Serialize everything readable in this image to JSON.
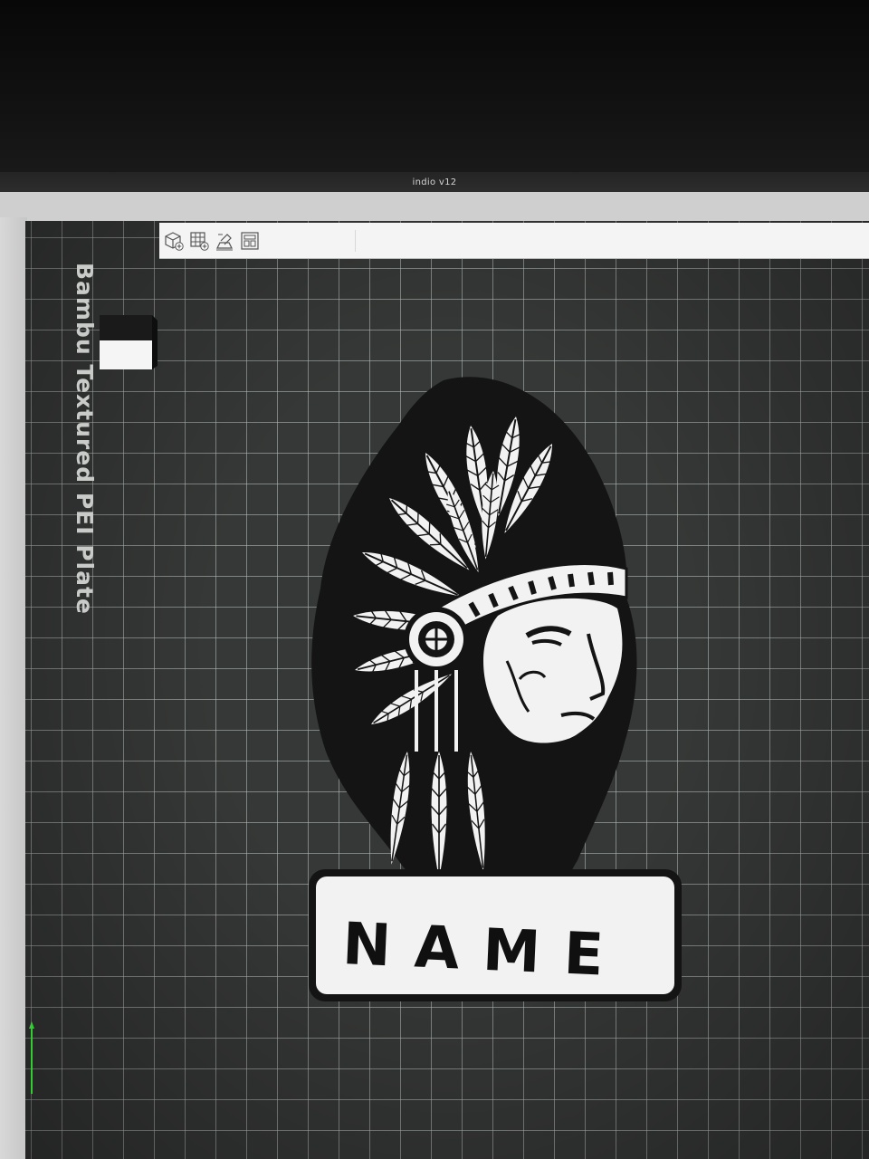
{
  "window": {
    "title": "indio v12"
  },
  "toolbar": {
    "buttons": [
      {
        "name": "add-object",
        "icon": "cube-add-icon"
      },
      {
        "name": "add-plate",
        "icon": "grid-add-icon"
      },
      {
        "name": "auto-orient",
        "icon": "auto-orient-icon"
      },
      {
        "name": "arrange",
        "icon": "arrange-icon"
      }
    ]
  },
  "plate": {
    "label": "Bambu Textured PEI Plate"
  },
  "model": {
    "icon": "chief-headdress-emblem",
    "name_plate_text": "NAME"
  },
  "colors": {
    "bed": "#363837",
    "grid_line": "#bec3c0",
    "toolbar_bg": "#f4f4f4",
    "model_black": "#141414",
    "model_white": "#f2f2f2",
    "axis_green": "#33cc33"
  }
}
